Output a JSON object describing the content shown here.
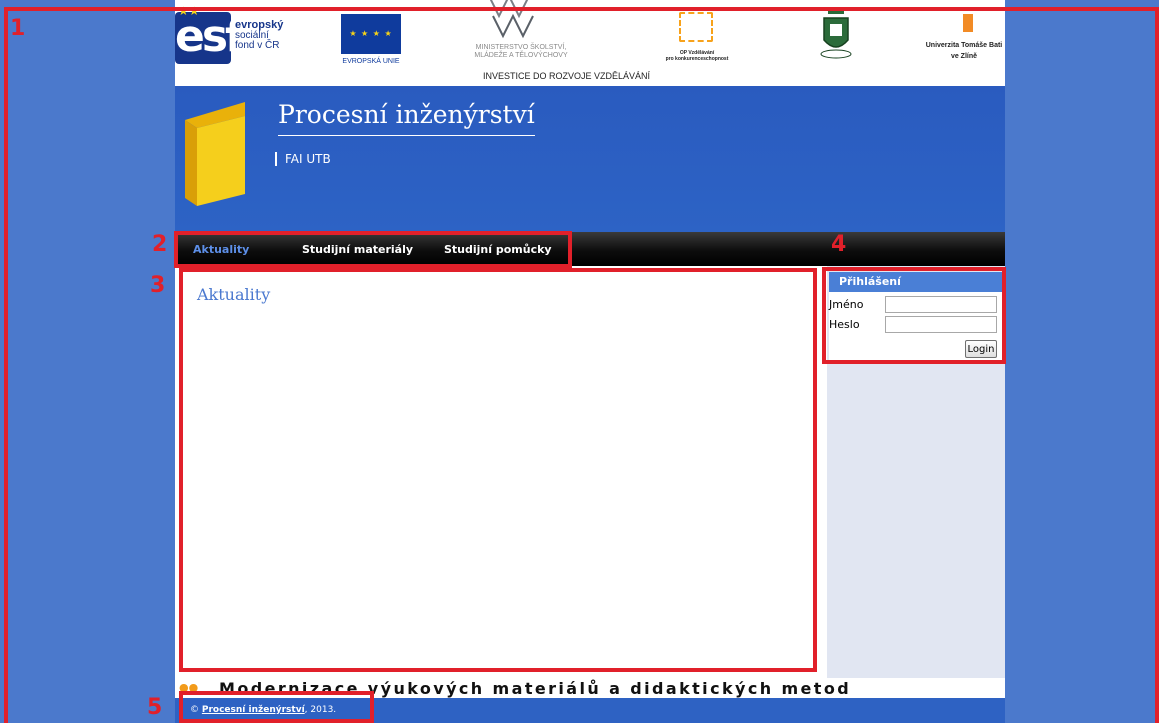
{
  "logos": {
    "esf_letters": "esf",
    "esf_line1": "evropský",
    "esf_line2": "sociální",
    "esf_line3": "fond v ČR",
    "eu_label": "EVROPSKÁ UNIE",
    "msmt_line1": "MINISTERSTVO ŠKOLSTVÍ,",
    "msmt_line2": "MLÁDEŽE A TĚLOVÝCHOVY",
    "invest_label": "INVESTICE DO ROZVOJE VZDĚLÁVÁNÍ",
    "op_line1": "OP Vzdělávání",
    "op_line2": "pro konkurenceschopnost",
    "utb_line1": "Univerzita Tomáše Bati",
    "utb_line2": "ve Zlíně"
  },
  "header": {
    "title": "Procesní inženýrství",
    "subtitle": "FAI UTB"
  },
  "nav": {
    "items": [
      {
        "label": "Aktuality"
      },
      {
        "label": "Studijní materiály"
      },
      {
        "label": "Studijní pomůcky"
      }
    ]
  },
  "main": {
    "title": "Aktuality"
  },
  "login": {
    "heading": "Přihlášení",
    "name_label": "Jméno",
    "password_label": "Heslo",
    "name_value": "",
    "password_value": "",
    "button_label": "Login"
  },
  "banner": {
    "text": "Modernizace výukových materiálů a didaktických metod"
  },
  "footer": {
    "copyright": "©",
    "link": "Procesní inženýrství",
    "year": ", 2013."
  },
  "annotations": {
    "n1": "1",
    "n2": "2",
    "n3": "3",
    "n4": "4",
    "n5": "5"
  },
  "colors": {
    "page_background": "#4b79cc",
    "annotation": "#e1202a",
    "header_blue": "#2a5bbf",
    "active_nav": "#5d8fe8",
    "book_yellow": "#f5cf1c"
  }
}
